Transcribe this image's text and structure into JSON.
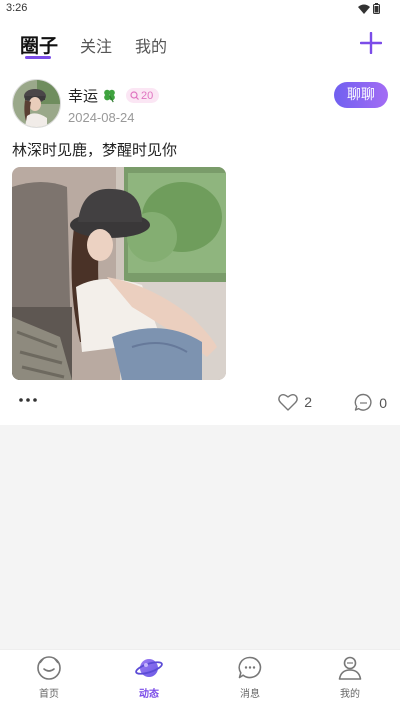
{
  "status_bar": {
    "time": "3:26"
  },
  "header": {
    "tabs": [
      {
        "label": "圈子",
        "active": true
      },
      {
        "label": "关注",
        "active": false
      },
      {
        "label": "我的",
        "active": false
      }
    ],
    "add_icon": "plus-icon"
  },
  "post": {
    "username": "幸运",
    "username_icon": "clover-icon",
    "level": "20",
    "date": "2024-08-24",
    "chat_label": "聊聊",
    "text": "林深时见鹿，梦醒时见你",
    "likes": "2",
    "comments": "0"
  },
  "bottom_nav": {
    "items": [
      {
        "label": "首页",
        "icon": "home-icon",
        "active": false
      },
      {
        "label": "动态",
        "icon": "planet-icon",
        "active": true
      },
      {
        "label": "消息",
        "icon": "message-icon",
        "active": false
      },
      {
        "label": "我的",
        "icon": "person-icon",
        "active": false
      }
    ]
  },
  "colors": {
    "accent": "#7b4ce8",
    "badge_bg": "#fbe6f4",
    "badge_text": "#e074c0"
  }
}
